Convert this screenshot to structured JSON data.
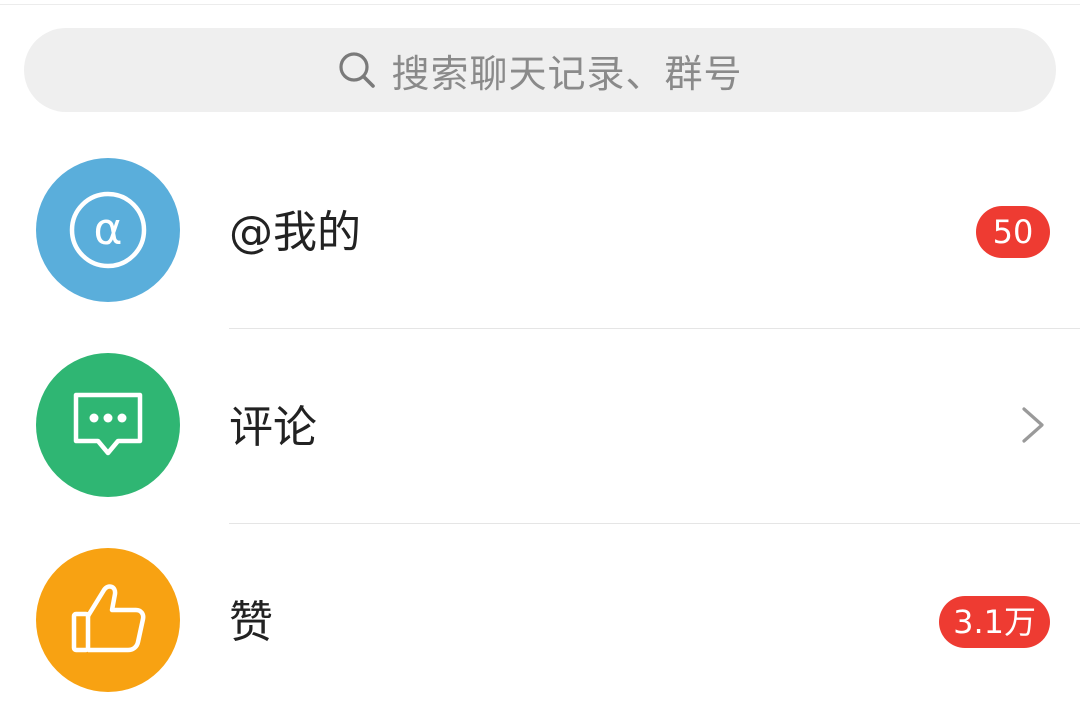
{
  "search": {
    "placeholder": "搜索聊天记录、群号",
    "icon": "search-icon"
  },
  "items": [
    {
      "label": "@我的",
      "icon": "at-sign-icon",
      "avatar_color": "#5aaedb",
      "badge": "50"
    },
    {
      "label": "评论",
      "icon": "comment-icon",
      "avatar_color": "#2fb673",
      "badge": ""
    },
    {
      "label": "赞",
      "icon": "thumbs-up-icon",
      "avatar_color": "#f8a212",
      "badge": "3.1万"
    }
  ],
  "colors": {
    "badge": "#ee3b32",
    "search_bg": "#efefef",
    "text": "#222222",
    "placeholder": "#8a8a8a"
  }
}
